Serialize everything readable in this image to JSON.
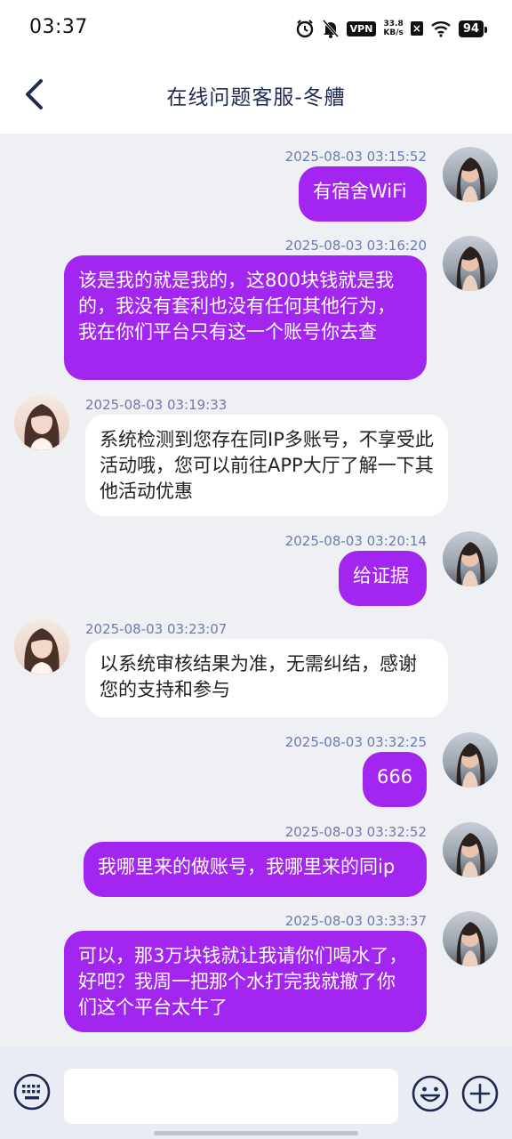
{
  "status_bar": {
    "time": "03:37",
    "vpn": "VPN",
    "net_speed_value": "33.8",
    "net_speed_unit": "KB/s",
    "battery": "94",
    "icons": [
      "alarm-icon",
      "mute-bell-icon",
      "vpn-icon",
      "no-sim-icon",
      "wifi-icon",
      "battery-icon"
    ]
  },
  "header": {
    "title": "在线问题客服-冬艚"
  },
  "messages": [
    {
      "side": "out",
      "time": "2025-08-03 03:15:52",
      "text": "有宿舍WiFi"
    },
    {
      "side": "out",
      "time": "2025-08-03 03:16:20",
      "text": "该是我的就是我的，这800块钱就是我的，我没有套利也没有任何其他行为，我在你们平台只有这一个账号你去查"
    },
    {
      "side": "in",
      "time": "2025-08-03 03:19:33",
      "text": "系统检测到您存在同IP多账号，不享受此活动哦，您可以前往APP大厅了解一下其他活动优惠"
    },
    {
      "side": "out",
      "time": "2025-08-03 03:20:14",
      "text": "给证据"
    },
    {
      "side": "in",
      "time": "2025-08-03 03:23:07",
      "text": "以系统审核结果为准，无需纠结，感谢您的支持和参与"
    },
    {
      "side": "out",
      "time": "2025-08-03 03:32:25",
      "text": "666"
    },
    {
      "side": "out",
      "time": "2025-08-03 03:32:52",
      "text": "我哪里来的做账号，我哪里来的同ip"
    },
    {
      "side": "out",
      "time": "2025-08-03 03:33:37",
      "text": "可以，那3万块钱就让我请你们喝水了，好吧？我周一把那个水打完我就撤了你们这个平台太牛了"
    }
  ],
  "input": {
    "value": "",
    "placeholder": ""
  },
  "colors": {
    "outgoing_bubble": "#a225f0",
    "incoming_bubble": "#ffffff",
    "timestamp": "#6b7bb1",
    "title": "#1d2a52"
  }
}
